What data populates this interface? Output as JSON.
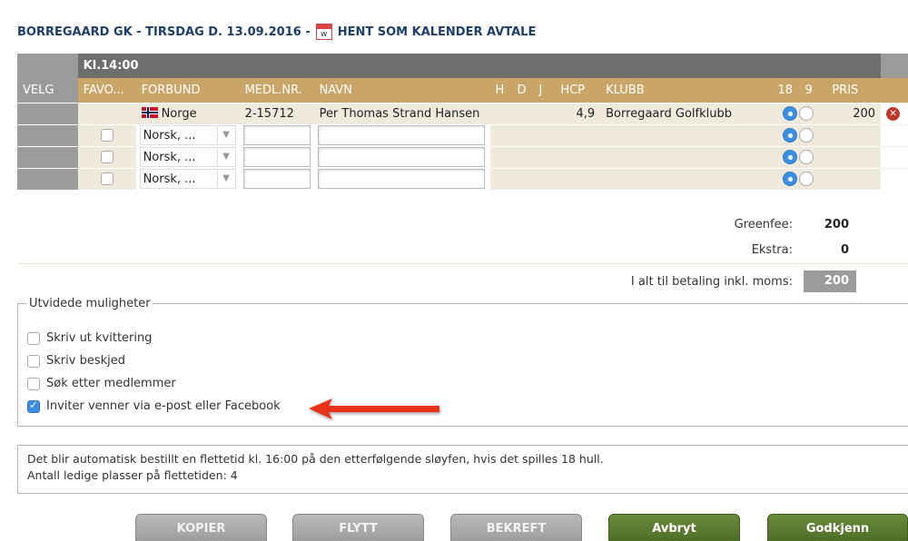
{
  "header": {
    "title": "BORREGAARD GK - TIRSDAG D. 13.09.2016 -",
    "calendar_icon_letter": "w",
    "calendar_link": "HENT SOM KALENDER AVTALE"
  },
  "table": {
    "time_label": "Kl.14:00",
    "columns": {
      "velg": "VELG",
      "favo": "FAVO...",
      "forbund": "FORBUND",
      "medlnr": "MEDL.NR.",
      "navn": "NAVN",
      "h": "H",
      "d": "D",
      "j": "J",
      "hcp": "HCP",
      "klubb": "KLUBB",
      "holes18": "18",
      "holes9": "9",
      "pris": "PRIS"
    },
    "player": {
      "forbund": "Norge",
      "medlnr": "2-15712",
      "navn": "Per Thomas Strand Hansen",
      "hcp": "4,9",
      "klubb": "Borregaard Golfklubb",
      "pris": "200"
    },
    "empty_rows": [
      {
        "forbund": "Norsk, ..."
      },
      {
        "forbund": "Norsk, ..."
      },
      {
        "forbund": "Norsk, ..."
      }
    ]
  },
  "totals": {
    "greenfee_label": "Greenfee:",
    "greenfee_value": "200",
    "ekstra_label": "Ekstra:",
    "ekstra_value": "0",
    "total_label": "I alt til betaling inkl. moms:",
    "total_value": "200"
  },
  "extended": {
    "legend": "Utvidede muligheter",
    "options": [
      {
        "label": "Skriv ut kvittering",
        "checked": false
      },
      {
        "label": "Skriv beskjed",
        "checked": false
      },
      {
        "label": "Søk etter medlemmer",
        "checked": false
      },
      {
        "label": "Inviter venner via e-post eller Facebook",
        "checked": true
      }
    ]
  },
  "info": {
    "line1": "Det blir automatisk bestillt en flettetid kl. 16:00 på den etterfølgende sløyfen, hvis det spilles 18 hull.",
    "line2": "Antall ledige plasser på flettetiden: 4"
  },
  "buttons": {
    "kopier": "KOPIER",
    "flytt": "FLYTT",
    "bekreft": "BEKREFT",
    "avbryt": "Avbryt",
    "godkjenn": "Godkjenn"
  },
  "colors": {
    "header_gold": "#c9a567",
    "row_bg": "#efeadb",
    "gray_col": "#9b9b9b",
    "green_button": "#5a7b30",
    "annotation_arrow": "#e8321c"
  }
}
